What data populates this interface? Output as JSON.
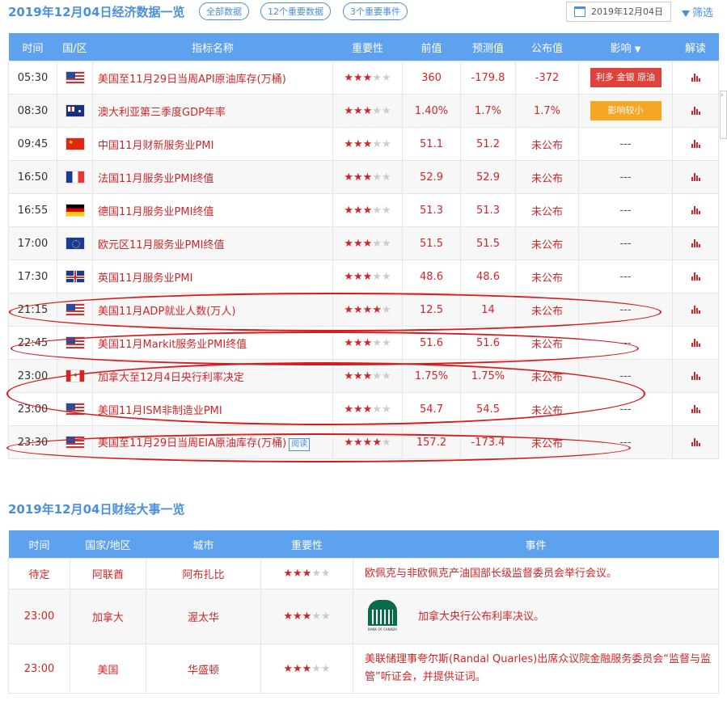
{
  "header": {
    "title": "2019年12月04日经济数据一览",
    "filters": [
      "全部数据",
      "12个重要数据",
      "3个重要事件"
    ],
    "date": "2019年12月04日",
    "filter_label": "筛选"
  },
  "table1": {
    "columns": [
      "时间",
      "国/区",
      "指标名称",
      "重要性",
      "前值",
      "预测值",
      "公布值",
      "影响",
      "解读"
    ],
    "rows": [
      {
        "time": "05:30",
        "flag": "us",
        "name": "美国至11月29日当周API原油库存(万桶)",
        "stars": 3,
        "prev": "360",
        "forecast": "-179.8",
        "actual": "-372",
        "impact": "利多 金银 原油",
        "impact_color": "#e1413b"
      },
      {
        "time": "08:30",
        "flag": "au",
        "name": "澳大利亚第三季度GDP年率",
        "stars": 3,
        "prev": "1.40%",
        "forecast": "1.7%",
        "actual": "1.7%",
        "impact": "影响较小",
        "impact_color": "#f5a623"
      },
      {
        "time": "09:45",
        "flag": "cn",
        "name": "中国11月财新服务业PMI",
        "stars": 3,
        "prev": "51.1",
        "forecast": "51.2",
        "actual": "未公布",
        "impact": "---"
      },
      {
        "time": "16:50",
        "flag": "fr",
        "name": "法国11月服务业PMI终值",
        "stars": 3,
        "prev": "52.9",
        "forecast": "52.9",
        "actual": "未公布",
        "impact": "---"
      },
      {
        "time": "16:55",
        "flag": "de",
        "name": "德国11月服务业PMI终值",
        "stars": 3,
        "prev": "51.3",
        "forecast": "51.3",
        "actual": "未公布",
        "impact": "---"
      },
      {
        "time": "17:00",
        "flag": "eu",
        "name": "欧元区11月服务业PMI终值",
        "stars": 3,
        "prev": "51.5",
        "forecast": "51.5",
        "actual": "未公布",
        "impact": "---"
      },
      {
        "time": "17:30",
        "flag": "gb",
        "name": "英国11月服务业PMI",
        "stars": 3,
        "prev": "48.6",
        "forecast": "48.6",
        "actual": "未公布",
        "impact": "---"
      },
      {
        "time": "21:15",
        "flag": "us",
        "name": "美国11月ADP就业人数(万人)",
        "stars": 4,
        "prev": "12.5",
        "forecast": "14",
        "actual": "未公布",
        "impact": "---"
      },
      {
        "time": "22:45",
        "flag": "us",
        "name": "美国11月Markit服务业PMI终值",
        "stars": 3,
        "prev": "51.6",
        "forecast": "51.6",
        "actual": "未公布",
        "impact": "---"
      },
      {
        "time": "23:00",
        "flag": "ca",
        "name": "加拿大至12月4日央行利率决定",
        "stars": 3,
        "prev": "1.75%",
        "forecast": "1.75%",
        "actual": "未公布",
        "impact": "---"
      },
      {
        "time": "23:00",
        "flag": "us",
        "name": "美国11月ISM非制造业PMI",
        "stars": 3,
        "prev": "54.7",
        "forecast": "54.5",
        "actual": "未公布",
        "impact": "---"
      },
      {
        "time": "23:30",
        "flag": "us",
        "name": "美国至11月29日当周EIA原油库存(万桶)",
        "read": "阅读",
        "stars": 4,
        "prev": "157.2",
        "forecast": "-173.4",
        "actual": "未公布",
        "impact": "---"
      }
    ]
  },
  "section2": {
    "title": "2019年12月04日财经大事一览",
    "columns": [
      "时间",
      "国家/地区",
      "城市",
      "重要性",
      "事件"
    ],
    "rows": [
      {
        "time": "待定",
        "country": "阿联酋",
        "city": "阿布扎比",
        "stars": 3,
        "event": "欧佩克与非欧佩克产油国部长级监督委员会举行会议。"
      },
      {
        "time": "23:00",
        "country": "加拿大",
        "city": "渥太华",
        "stars": 3,
        "event": "加拿大央行公布利率决议。",
        "logo_text": "BANK OF CANADA"
      },
      {
        "time": "23:00",
        "country": "美国",
        "city": "华盛顿",
        "stars": 3,
        "event": "美联储理事夸尔斯(Randal Quarles)出席众议院金融服务委员会“监督与监管”听证会，并提供证词。"
      }
    ]
  },
  "colors": {
    "accent": "#5da1ef",
    "red": "#d0262a",
    "annotation": "#d71a1a"
  }
}
